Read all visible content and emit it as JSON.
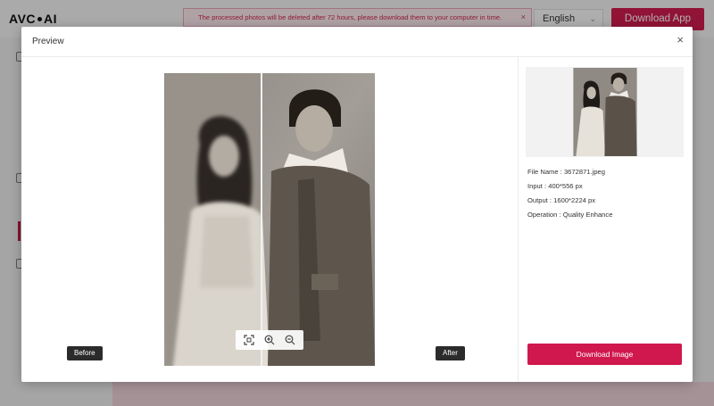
{
  "app": {
    "logo_left": "AVC",
    "logo_right": "AI",
    "notice": "The processed photos will be deleted after 72 hours, please download them to your computer in time.",
    "notice_close": "×",
    "language": "English",
    "download_app": "Download App"
  },
  "modal": {
    "title": "Preview",
    "close": "×",
    "before_label": "Before",
    "after_label": "After",
    "download_image": "Download Image"
  },
  "info": {
    "file_name_label": "File Name :",
    "file_name": "3672871.jpeg",
    "input_label": "Input :",
    "input": "400*556 px",
    "output_label": "Output :",
    "output": "1600*2224 px",
    "operation_label": "Operation :",
    "operation": "Quality Enhance"
  },
  "icons": {
    "fit": "fit-screen-icon",
    "zoom_in": "zoom-in-icon",
    "zoom_out": "zoom-out-icon",
    "close": "close-icon"
  },
  "colors": {
    "brand": "#d01c4e",
    "notice_text": "#cc2a4b",
    "tag_bg": "#2b2b2b"
  }
}
